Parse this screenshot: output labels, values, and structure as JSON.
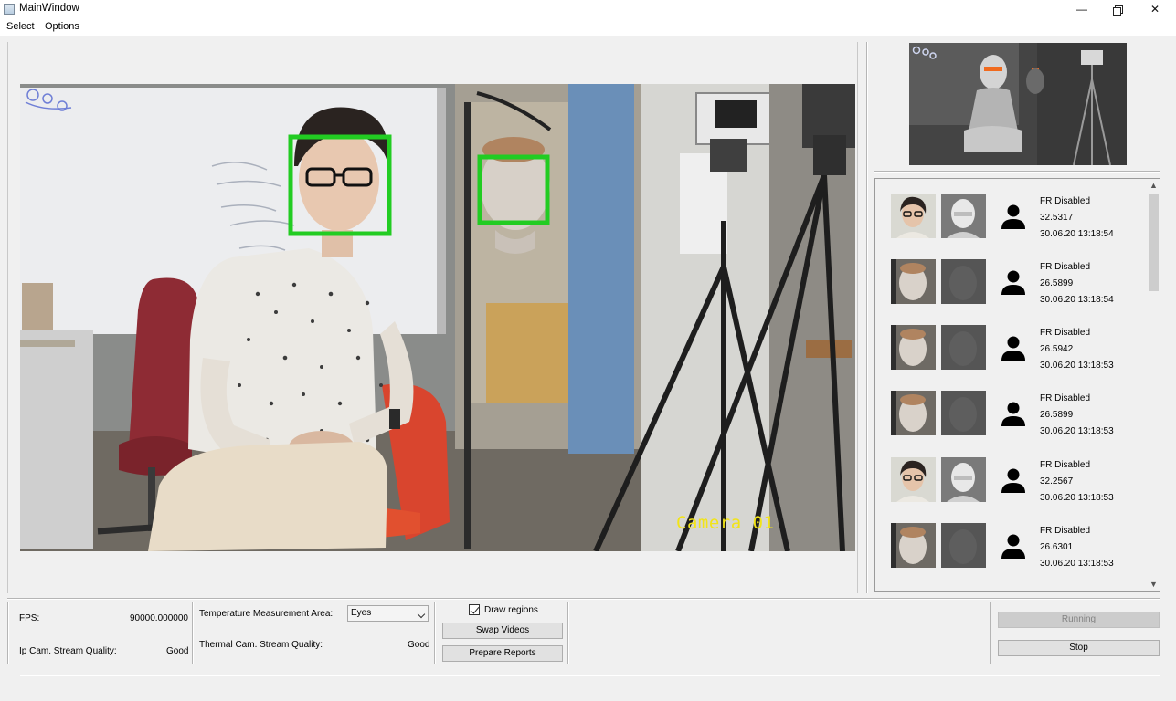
{
  "window": {
    "title": "MainWindow",
    "minimize": "—",
    "close": "✕"
  },
  "menu": {
    "items": [
      "Select",
      "Options"
    ]
  },
  "video": {
    "camera_label": "Camera 01"
  },
  "detections": [
    {
      "status": "FR Disabled",
      "temperature": "32.5317",
      "timestamp": "30.06.20 13:18:54",
      "face": "man",
      "thermal": "hot"
    },
    {
      "status": "FR Disabled",
      "temperature": "26.5899",
      "timestamp": "30.06.20 13:18:54",
      "face": "mannequin",
      "thermal": "cool"
    },
    {
      "status": "FR Disabled",
      "temperature": "26.5942",
      "timestamp": "30.06.20 13:18:53",
      "face": "mannequin",
      "thermal": "cool"
    },
    {
      "status": "FR Disabled",
      "temperature": "26.5899",
      "timestamp": "30.06.20 13:18:53",
      "face": "mannequin",
      "thermal": "cool"
    },
    {
      "status": "FR Disabled",
      "temperature": "32.2567",
      "timestamp": "30.06.20 13:18:53",
      "face": "man",
      "thermal": "hot"
    },
    {
      "status": "FR Disabled",
      "temperature": "26.6301",
      "timestamp": "30.06.20 13:18:53",
      "face": "mannequin",
      "thermal": "cool"
    }
  ],
  "stats": {
    "fps_label": "FPS:",
    "fps_value": "90000.000000",
    "ip_quality_label": "Ip Cam. Stream Quality:",
    "ip_quality_value": "Good",
    "temp_area_label": "Temperature Measurement Area:",
    "temp_area_value": "Eyes",
    "thermal_quality_label": "Thermal Cam. Stream Quality:",
    "thermal_quality_value": "Good"
  },
  "controls": {
    "draw_regions_label": "Draw regions",
    "draw_regions_checked": true,
    "swap_videos_label": "Swap Videos",
    "prepare_reports_label": "Prepare Reports",
    "running_label": "Running",
    "stop_label": "Stop"
  },
  "colors": {
    "face_box": "#22cc22",
    "camera_label": "#f2e418",
    "thermal_hotspot": "#f06a1e"
  }
}
